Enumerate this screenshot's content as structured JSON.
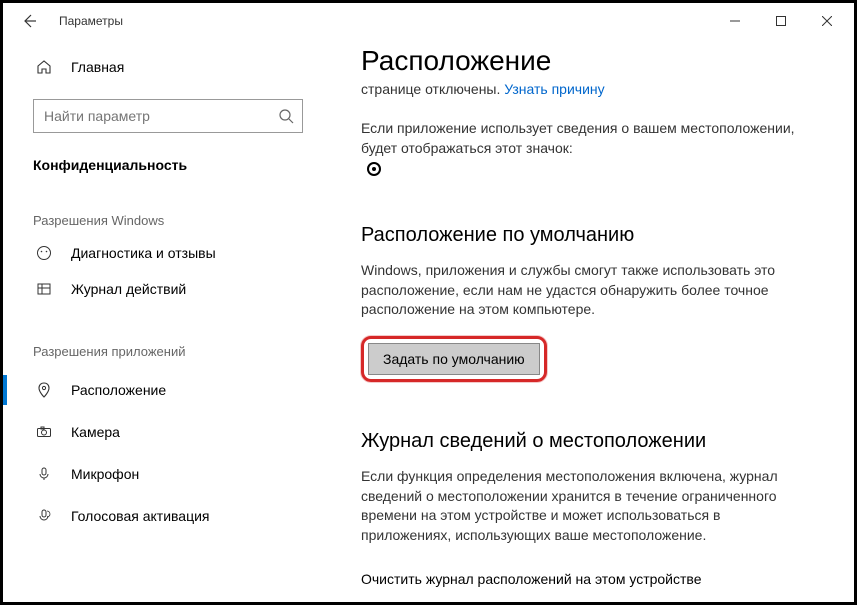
{
  "titlebar": {
    "title": "Параметры"
  },
  "sidebar": {
    "home": "Главная",
    "search_placeholder": "Найти параметр",
    "section": "Конфиденциальность",
    "group1": "Разрешения Windows",
    "item_diag": "Диагностика и отзывы",
    "item_activity": "Журнал действий",
    "group2": "Разрешения приложений",
    "item_location": "Расположение",
    "item_camera": "Камера",
    "item_mic": "Микрофон",
    "item_voice": "Голосовая активация"
  },
  "main": {
    "heading": "Расположение",
    "disabled_prefix": "странице отключены. ",
    "disabled_link": "Узнать причину",
    "usage_text": "Если приложение использует сведения о вашем местоположении, будет отображаться этот значок:",
    "default_heading": "Расположение по умолчанию",
    "default_text": "Windows, приложения и службы смогут также использовать это расположение, если нам не удастся обнаружить более точное расположение на этом компьютере.",
    "default_button": "Задать по умолчанию",
    "history_heading": "Журнал сведений о местоположении",
    "history_text": "Если функция определения местоположения включена, журнал сведений о местоположении хранится в течение ограниченного времени на этом устройстве и может использоваться в приложениях, использующих ваше местоположение.",
    "clear_label": "Очистить журнал расположений на этом устройстве"
  }
}
